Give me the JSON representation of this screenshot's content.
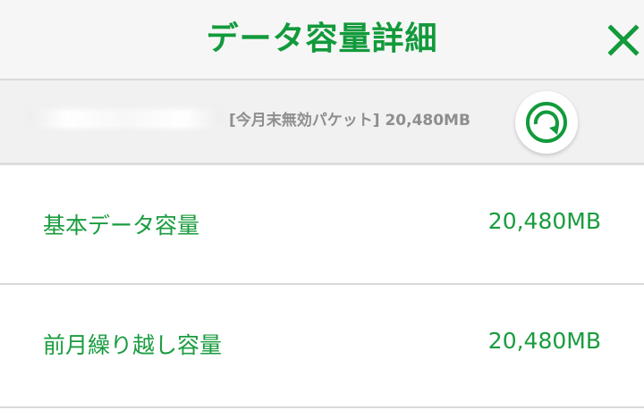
{
  "header": {
    "title": "データ容量詳細",
    "close_icon": "close-icon"
  },
  "info": {
    "unused_packet": "[今月末無効パケット] 20,480MB",
    "refresh_icon": "refresh-icon"
  },
  "rows": [
    {
      "label": "基本データ容量",
      "value": "20,480MB"
    },
    {
      "label": "前月繰り越し容量",
      "value": "20,480MB"
    }
  ],
  "colors": {
    "accent": "#129a3b",
    "muted_text": "#8e8e8e",
    "header_bg": "#f6f6f6",
    "band_bg": "#f1f1f1"
  }
}
